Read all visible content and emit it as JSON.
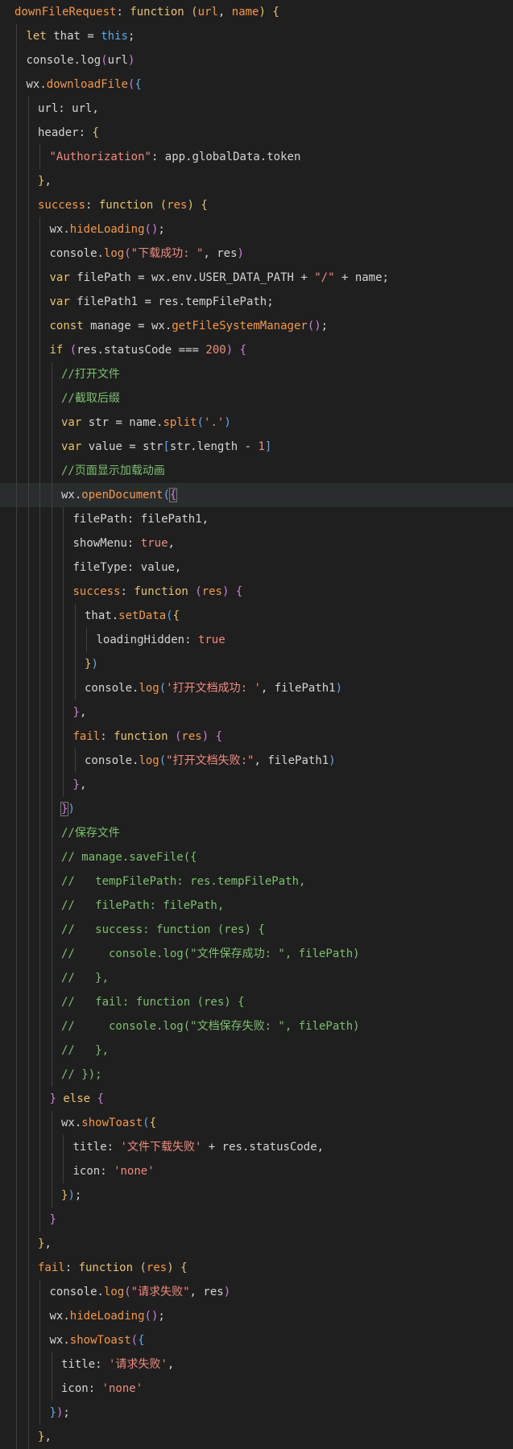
{
  "editor": {
    "theme": {
      "background": "#1f1f1f",
      "current_line": "#2a2d2e",
      "indent_guide": "#404040",
      "keyword": "#e8c170",
      "function": "#f2984b",
      "string": "#f08a7e",
      "comment": "#7cbf6e",
      "plain": "#d4d4d4",
      "bracket_level_1": "#e8c170",
      "bracket_level_2": "#cf7fd8",
      "bracket_level_3": "#5fa8e8"
    },
    "current_line_index": 20,
    "lines": [
      {
        "indent": 0,
        "tokens": [
          [
            "fn",
            "downFileRequest"
          ],
          [
            "pl",
            ": "
          ],
          [
            "kw",
            "function"
          ],
          [
            "pl",
            " "
          ],
          [
            "b1",
            "("
          ],
          [
            "prm",
            "url"
          ],
          [
            "pl",
            ", "
          ],
          [
            "prm",
            "name"
          ],
          [
            "b1",
            ")"
          ],
          [
            "pl",
            " "
          ],
          [
            "b1",
            "{"
          ]
        ]
      },
      {
        "indent": 1,
        "tokens": [
          [
            "kw",
            "let"
          ],
          [
            "pl",
            " that = "
          ],
          [
            "this",
            "this"
          ],
          [
            "pl",
            ";"
          ]
        ]
      },
      {
        "indent": 1,
        "tokens": [
          [
            "pl",
            "console.log"
          ],
          [
            "b2",
            "("
          ],
          [
            "pl",
            "url"
          ],
          [
            "b2",
            ")"
          ]
        ]
      },
      {
        "indent": 1,
        "tokens": [
          [
            "pl",
            "wx."
          ],
          [
            "fn",
            "downloadFile"
          ],
          [
            "b2",
            "("
          ],
          [
            "b3",
            "{"
          ]
        ]
      },
      {
        "indent": 2,
        "tokens": [
          [
            "pl",
            "url: url,"
          ]
        ]
      },
      {
        "indent": 2,
        "tokens": [
          [
            "pl",
            "header: "
          ],
          [
            "b1",
            "{"
          ]
        ]
      },
      {
        "indent": 3,
        "tokens": [
          [
            "str",
            "\"Authorization\""
          ],
          [
            "pl",
            ": app.globalData.token"
          ]
        ]
      },
      {
        "indent": 2,
        "tokens": [
          [
            "b1",
            "}"
          ],
          [
            "pl",
            ","
          ]
        ]
      },
      {
        "indent": 2,
        "tokens": [
          [
            "fn",
            "success"
          ],
          [
            "pl",
            ": "
          ],
          [
            "kw",
            "function"
          ],
          [
            "pl",
            " "
          ],
          [
            "b1",
            "("
          ],
          [
            "prm",
            "res"
          ],
          [
            "b1",
            ")"
          ],
          [
            "pl",
            " "
          ],
          [
            "b1",
            "{"
          ]
        ]
      },
      {
        "indent": 3,
        "tokens": [
          [
            "pl",
            "wx."
          ],
          [
            "fn",
            "hideLoading"
          ],
          [
            "b2",
            "()"
          ],
          [
            "pl",
            ";"
          ]
        ]
      },
      {
        "indent": 3,
        "tokens": [
          [
            "pl",
            "console."
          ],
          [
            "fn",
            "log"
          ],
          [
            "b2",
            "("
          ],
          [
            "str",
            "\"下载成功: \""
          ],
          [
            "pl",
            ", res"
          ],
          [
            "b2",
            ")"
          ]
        ]
      },
      {
        "indent": 3,
        "tokens": [
          [
            "kw",
            "var"
          ],
          [
            "pl",
            " filePath = wx.env.USER_DATA_PATH + "
          ],
          [
            "str",
            "\"/\""
          ],
          [
            "pl",
            " + name;"
          ]
        ]
      },
      {
        "indent": 3,
        "tokens": [
          [
            "kw",
            "var"
          ],
          [
            "pl",
            " filePath1 = res.tempFilePath;"
          ]
        ]
      },
      {
        "indent": 3,
        "tokens": [
          [
            "kw",
            "const"
          ],
          [
            "pl",
            " manage = wx."
          ],
          [
            "fn",
            "getFileSystemManager"
          ],
          [
            "b2",
            "()"
          ],
          [
            "pl",
            ";"
          ]
        ]
      },
      {
        "indent": 3,
        "tokens": [
          [
            "kw",
            "if"
          ],
          [
            "pl",
            " "
          ],
          [
            "b2",
            "("
          ],
          [
            "pl",
            "res.statusCode === "
          ],
          [
            "num",
            "200"
          ],
          [
            "b2",
            ")"
          ],
          [
            "pl",
            " "
          ],
          [
            "b2",
            "{"
          ]
        ]
      },
      {
        "indent": 4,
        "tokens": [
          [
            "cm",
            "//打开文件"
          ]
        ]
      },
      {
        "indent": 4,
        "tokens": [
          [
            "cm",
            "//截取后缀"
          ]
        ]
      },
      {
        "indent": 4,
        "tokens": [
          [
            "kw",
            "var"
          ],
          [
            "pl",
            " str = name."
          ],
          [
            "fn",
            "split"
          ],
          [
            "b3",
            "("
          ],
          [
            "str",
            "'.'"
          ],
          [
            "b3",
            ")"
          ]
        ]
      },
      {
        "indent": 4,
        "tokens": [
          [
            "kw",
            "var"
          ],
          [
            "pl",
            " value = str"
          ],
          [
            "b3",
            "["
          ],
          [
            "pl",
            "str.length - "
          ],
          [
            "num",
            "1"
          ],
          [
            "b3",
            "]"
          ]
        ]
      },
      {
        "indent": 4,
        "tokens": [
          [
            "cm",
            "//页面显示加载动画"
          ]
        ]
      },
      {
        "indent": 4,
        "tokens": [
          [
            "pl",
            "wx."
          ],
          [
            "fn",
            "openDocument"
          ],
          [
            "b3",
            "("
          ],
          [
            "caret",
            "{"
          ]
        ]
      },
      {
        "indent": 5,
        "tokens": [
          [
            "pl",
            "filePath: filePath1,"
          ]
        ]
      },
      {
        "indent": 5,
        "tokens": [
          [
            "pl",
            "showMenu: "
          ],
          [
            "lit",
            "true"
          ],
          [
            "pl",
            ","
          ]
        ]
      },
      {
        "indent": 5,
        "tokens": [
          [
            "pl",
            "fileType: value,"
          ]
        ]
      },
      {
        "indent": 5,
        "tokens": [
          [
            "fn",
            "success"
          ],
          [
            "pl",
            ": "
          ],
          [
            "kw",
            "function"
          ],
          [
            "pl",
            " "
          ],
          [
            "b2",
            "("
          ],
          [
            "prm",
            "res"
          ],
          [
            "b2",
            ")"
          ],
          [
            "pl",
            " "
          ],
          [
            "b2",
            "{"
          ]
        ]
      },
      {
        "indent": 6,
        "tokens": [
          [
            "pl",
            "that."
          ],
          [
            "fn",
            "setData"
          ],
          [
            "b3",
            "("
          ],
          [
            "b1",
            "{"
          ]
        ]
      },
      {
        "indent": 7,
        "tokens": [
          [
            "pl",
            "loadingHidden: "
          ],
          [
            "lit",
            "true"
          ]
        ]
      },
      {
        "indent": 6,
        "tokens": [
          [
            "b1",
            "}"
          ],
          [
            "b3",
            ")"
          ]
        ]
      },
      {
        "indent": 6,
        "tokens": [
          [
            "pl",
            "console."
          ],
          [
            "fn",
            "log"
          ],
          [
            "b3",
            "("
          ],
          [
            "str",
            "'打开文档成功: '"
          ],
          [
            "pl",
            ", filePath1"
          ],
          [
            "b3",
            ")"
          ]
        ]
      },
      {
        "indent": 5,
        "tokens": [
          [
            "b2",
            "}"
          ],
          [
            "pl",
            ","
          ]
        ]
      },
      {
        "indent": 5,
        "tokens": [
          [
            "fn",
            "fail"
          ],
          [
            "pl",
            ": "
          ],
          [
            "kw",
            "function"
          ],
          [
            "pl",
            " "
          ],
          [
            "b2",
            "("
          ],
          [
            "prm",
            "res"
          ],
          [
            "b2",
            ")"
          ],
          [
            "pl",
            " "
          ],
          [
            "b2",
            "{"
          ]
        ]
      },
      {
        "indent": 6,
        "tokens": [
          [
            "pl",
            "console."
          ],
          [
            "fn",
            "log"
          ],
          [
            "b3",
            "("
          ],
          [
            "str",
            "\"打开文档失败:\""
          ],
          [
            "pl",
            ", filePath1"
          ],
          [
            "b3",
            ")"
          ]
        ]
      },
      {
        "indent": 5,
        "tokens": [
          [
            "b2",
            "}"
          ],
          [
            "pl",
            ","
          ]
        ]
      },
      {
        "indent": 4,
        "tokens": [
          [
            "caret",
            "}"
          ],
          [
            "b3",
            ")"
          ]
        ]
      },
      {
        "indent": 4,
        "tokens": [
          [
            "cm",
            "//保存文件"
          ]
        ]
      },
      {
        "indent": 4,
        "tokens": [
          [
            "cm",
            "// manage.saveFile({"
          ]
        ]
      },
      {
        "indent": 4,
        "tokens": [
          [
            "cm",
            "//   tempFilePath: res.tempFilePath,"
          ]
        ]
      },
      {
        "indent": 4,
        "tokens": [
          [
            "cm",
            "//   filePath: filePath,"
          ]
        ]
      },
      {
        "indent": 4,
        "tokens": [
          [
            "cm",
            "//   success: function (res) {"
          ]
        ]
      },
      {
        "indent": 4,
        "tokens": [
          [
            "cm",
            "//     console.log(\"文件保存成功: \", filePath)"
          ]
        ]
      },
      {
        "indent": 4,
        "tokens": [
          [
            "cm",
            "//   },"
          ]
        ]
      },
      {
        "indent": 4,
        "tokens": [
          [
            "cm",
            "//   fail: function (res) {"
          ]
        ]
      },
      {
        "indent": 4,
        "tokens": [
          [
            "cm",
            "//     console.log(\"文档保存失败: \", filePath)"
          ]
        ]
      },
      {
        "indent": 4,
        "tokens": [
          [
            "cm",
            "//   },"
          ]
        ]
      },
      {
        "indent": 4,
        "tokens": [
          [
            "cm",
            "// });"
          ]
        ]
      },
      {
        "indent": 3,
        "tokens": [
          [
            "b2",
            "}"
          ],
          [
            "pl",
            " "
          ],
          [
            "kw",
            "else"
          ],
          [
            "pl",
            " "
          ],
          [
            "b2",
            "{"
          ]
        ]
      },
      {
        "indent": 4,
        "tokens": [
          [
            "pl",
            "wx."
          ],
          [
            "fn",
            "showToast"
          ],
          [
            "b3",
            "("
          ],
          [
            "b1",
            "{"
          ]
        ]
      },
      {
        "indent": 5,
        "tokens": [
          [
            "pl",
            "title: "
          ],
          [
            "str",
            "'文件下载失败'"
          ],
          [
            "pl",
            " + res.statusCode,"
          ]
        ]
      },
      {
        "indent": 5,
        "tokens": [
          [
            "pl",
            "icon: "
          ],
          [
            "str",
            "'none'"
          ]
        ]
      },
      {
        "indent": 4,
        "tokens": [
          [
            "b1",
            "}"
          ],
          [
            "b3",
            ")"
          ],
          [
            "pl",
            ";"
          ]
        ]
      },
      {
        "indent": 3,
        "tokens": [
          [
            "b2",
            "}"
          ]
        ]
      },
      {
        "indent": 2,
        "tokens": [
          [
            "b1",
            "}"
          ],
          [
            "pl",
            ","
          ]
        ]
      },
      {
        "indent": 2,
        "tokens": [
          [
            "fn",
            "fail"
          ],
          [
            "pl",
            ": "
          ],
          [
            "kw",
            "function"
          ],
          [
            "pl",
            " "
          ],
          [
            "b1",
            "("
          ],
          [
            "prm",
            "res"
          ],
          [
            "b1",
            ")"
          ],
          [
            "pl",
            " "
          ],
          [
            "b1",
            "{"
          ]
        ]
      },
      {
        "indent": 3,
        "tokens": [
          [
            "pl",
            "console."
          ],
          [
            "fn",
            "log"
          ],
          [
            "b2",
            "("
          ],
          [
            "str",
            "\"请求失败\""
          ],
          [
            "pl",
            ", res"
          ],
          [
            "b2",
            ")"
          ]
        ]
      },
      {
        "indent": 3,
        "tokens": [
          [
            "pl",
            "wx."
          ],
          [
            "fn",
            "hideLoading"
          ],
          [
            "b2",
            "()"
          ],
          [
            "pl",
            ";"
          ]
        ]
      },
      {
        "indent": 3,
        "tokens": [
          [
            "pl",
            "wx."
          ],
          [
            "fn",
            "showToast"
          ],
          [
            "b2",
            "("
          ],
          [
            "b3",
            "{"
          ]
        ]
      },
      {
        "indent": 4,
        "tokens": [
          [
            "pl",
            "title: "
          ],
          [
            "str",
            "'请求失败'"
          ],
          [
            "pl",
            ","
          ]
        ]
      },
      {
        "indent": 4,
        "tokens": [
          [
            "pl",
            "icon: "
          ],
          [
            "str",
            "'none'"
          ]
        ]
      },
      {
        "indent": 3,
        "tokens": [
          [
            "b3",
            "}"
          ],
          [
            "b2",
            ")"
          ],
          [
            "pl",
            ";"
          ]
        ]
      },
      {
        "indent": 2,
        "tokens": [
          [
            "b1",
            "}"
          ],
          [
            "pl",
            ","
          ]
        ]
      }
    ]
  }
}
